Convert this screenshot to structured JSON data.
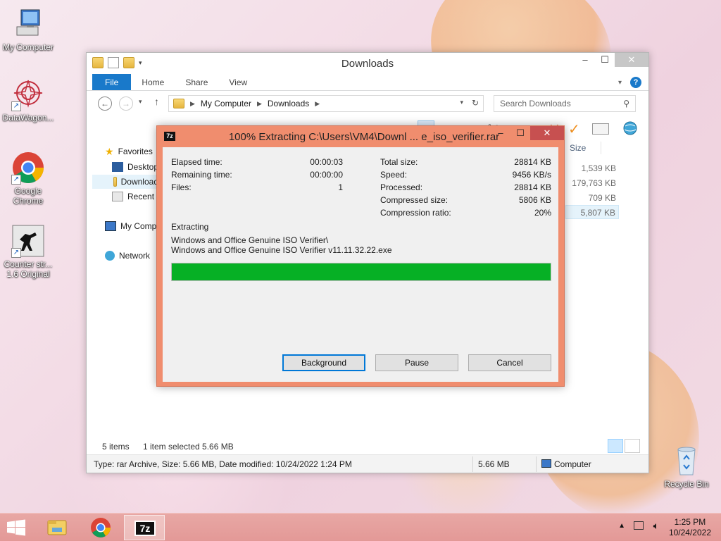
{
  "desktop": {
    "icons": [
      {
        "label": "My Computer"
      },
      {
        "label": "DataWagon..."
      },
      {
        "label": "Google Chrome"
      },
      {
        "label": "Counter str... 1.6 Original"
      },
      {
        "label": "Recycle Bin"
      }
    ]
  },
  "explorer": {
    "title": "Downloads",
    "tabs": {
      "file": "File",
      "home": "Home",
      "share": "Share",
      "view": "View"
    },
    "address": {
      "seg1": "My Computer",
      "seg2": "Downloads"
    },
    "search_placeholder": "Search Downloads",
    "nav": {
      "favorites": "Favorites",
      "desktop": "Desktop",
      "downloads": "Downloads",
      "recent": "Recent places",
      "my_computer": "My Computer",
      "network": "Network"
    },
    "size_header": "Size",
    "sizes": [
      "1,539 KB",
      "179,763 KB",
      "709 KB",
      "5,807 KB"
    ],
    "items_count": "5 items",
    "selected_info": "1 item selected  5.66 MB",
    "status": {
      "details": "Type: rar Archive, Size: 5.66 MB, Date modified: 10/24/2022 1:24 PM",
      "size": "5.66 MB",
      "location": "Computer"
    }
  },
  "dialog": {
    "title": "100% Extracting C:\\Users\\VM4\\Downl ... e_iso_verifier.rar",
    "logo": "7z",
    "left": [
      {
        "label": "Elapsed time:",
        "value": "00:00:03"
      },
      {
        "label": "Remaining time:",
        "value": "00:00:00"
      },
      {
        "label": "Files:",
        "value": "1"
      }
    ],
    "right": [
      {
        "label": "Total size:",
        "value": "28814 KB"
      },
      {
        "label": "Speed:",
        "value": "9456 KB/s"
      },
      {
        "label": "Processed:",
        "value": "28814 KB"
      },
      {
        "label": "Compressed size:",
        "value": "5806 KB"
      },
      {
        "label": "Compression ratio:",
        "value": "20%"
      }
    ],
    "action": "Extracting",
    "path1": "Windows and Office Genuine ISO Verifier\\",
    "path2": "Windows and Office Genuine ISO Verifier v11.11.32.22.exe",
    "progress_percent": 100,
    "progress_color": "#06b025",
    "buttons": {
      "background": "Background",
      "pause": "Pause",
      "cancel": "Cancel"
    }
  },
  "taskbar": {
    "time": "1:25 PM",
    "date": "10/24/2022",
    "active_app_label": "7z"
  }
}
